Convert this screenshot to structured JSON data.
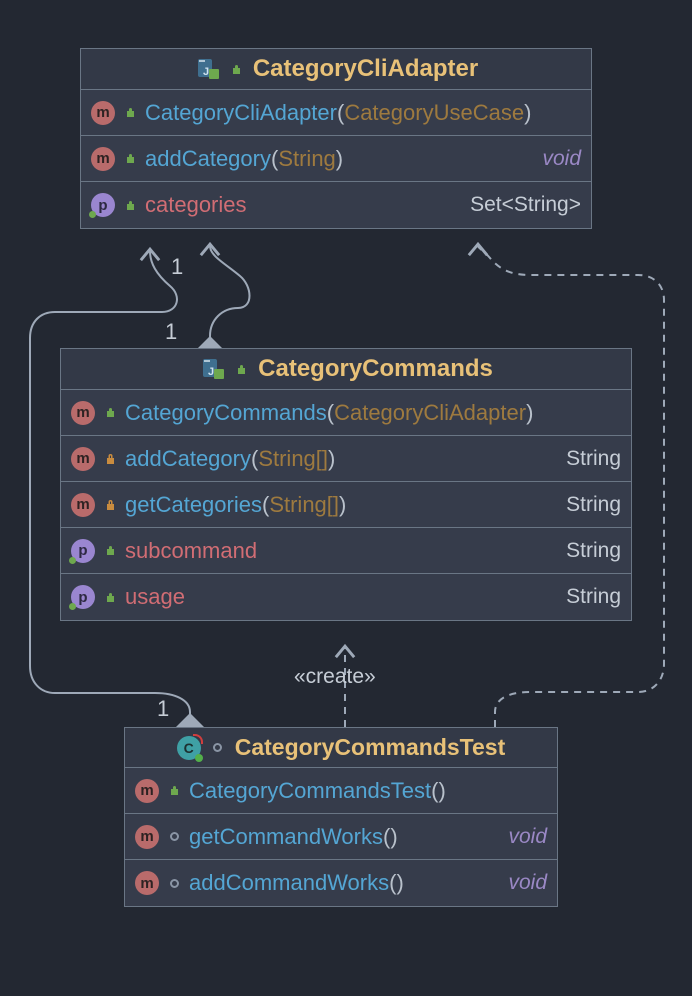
{
  "boxes": {
    "adapter": {
      "title": "CategoryCliAdapter",
      "members": [
        {
          "kind": "m",
          "vis": "public",
          "name": "CategoryCliAdapter",
          "sig_params": "CategoryUseCase",
          "ret": "",
          "retStyle": "",
          "nameStyle": "fn"
        },
        {
          "kind": "m",
          "vis": "public",
          "name": "addCategory",
          "sig_params": "String",
          "ret": "void",
          "retStyle": "italic",
          "nameStyle": "fn"
        },
        {
          "kind": "p",
          "vis": "public",
          "name": "categories",
          "sig_params": null,
          "ret": "Set<String>",
          "retStyle": "",
          "nameStyle": "prop"
        }
      ]
    },
    "commands": {
      "title": "CategoryCommands",
      "members": [
        {
          "kind": "m",
          "vis": "public",
          "name": "CategoryCommands",
          "sig_params": "CategoryCliAdapter",
          "ret": "",
          "retStyle": "",
          "nameStyle": "fn",
          "group": 0
        },
        {
          "kind": "m",
          "vis": "private",
          "name": "addCategory",
          "sig_params": "String[]",
          "ret": "String",
          "retStyle": "",
          "nameStyle": "fn",
          "group": 1
        },
        {
          "kind": "m",
          "vis": "private",
          "name": "getCategories",
          "sig_params": "String[]",
          "ret": "String",
          "retStyle": "",
          "nameStyle": "fn",
          "group": 1
        },
        {
          "kind": "p",
          "vis": "public",
          "name": "subcommand",
          "sig_params": null,
          "ret": "String",
          "retStyle": "",
          "nameStyle": "prop",
          "group": 2
        },
        {
          "kind": "p",
          "vis": "public",
          "name": "usage",
          "sig_params": null,
          "ret": "String",
          "retStyle": "",
          "nameStyle": "prop",
          "group": 2
        }
      ]
    },
    "test": {
      "title": "CategoryCommandsTest",
      "members": [
        {
          "kind": "m",
          "vis": "public",
          "name": "CategoryCommandsTest",
          "sig_params": "",
          "ret": "",
          "retStyle": "",
          "nameStyle": "fn"
        },
        {
          "kind": "m",
          "vis": "gray",
          "name": "getCommandWorks",
          "sig_params": "",
          "ret": "void",
          "retStyle": "italic",
          "nameStyle": "fn"
        },
        {
          "kind": "m",
          "vis": "gray",
          "name": "addCommandWorks",
          "sig_params": "",
          "ret": "void",
          "retStyle": "italic",
          "nameStyle": "fn"
        }
      ]
    }
  },
  "labels": {
    "create": "«create»",
    "mult1_a": "1",
    "mult1_b": "1",
    "mult1_c": "1"
  }
}
